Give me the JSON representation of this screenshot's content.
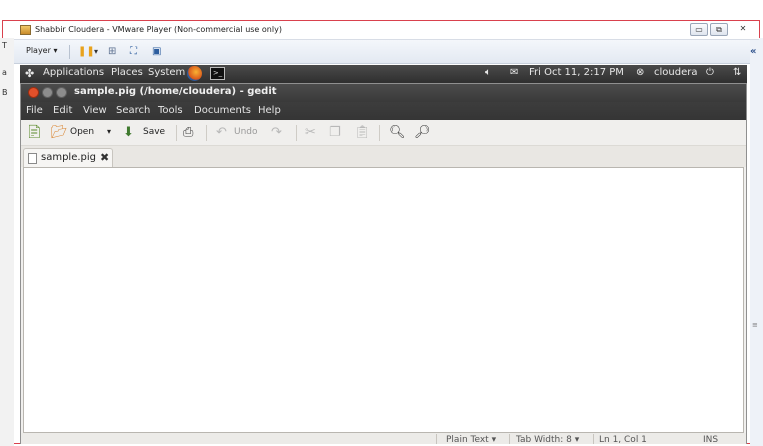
{
  "vmware": {
    "title": "Shabbir Cloudera - VMware Player (Non-commercial use only)",
    "player_label": "Player",
    "minimize": "▭",
    "restore": "⧉",
    "close": "✕"
  },
  "host_strip": {
    "letters": [
      "T",
      "a",
      "B"
    ],
    "chevron": "«",
    "grip": "≡"
  },
  "panel": {
    "applications": "Applications",
    "places": "Places",
    "system": "System",
    "datetime": "Fri Oct 11,  2:17 PM",
    "user": "cloudera"
  },
  "gedit": {
    "title": "sample.pig (/home/cloudera) - gedit",
    "menu": [
      "File",
      "Edit",
      "View",
      "Search",
      "Tools",
      "Documents",
      "Help"
    ],
    "toolbar": {
      "open": "Open",
      "save": "Save",
      "undo": "Undo"
    },
    "tab_label": "sample.pig",
    "status": {
      "language": "Plain Text ▾",
      "tab_width": "Tab Width: 8 ▾",
      "position": "Ln 1, Col 1",
      "mode": "INS"
    }
  },
  "colors": {
    "panel_bg": "#3a3a3a",
    "close_dot": "#e2502a",
    "border_red": "#d9414d"
  }
}
